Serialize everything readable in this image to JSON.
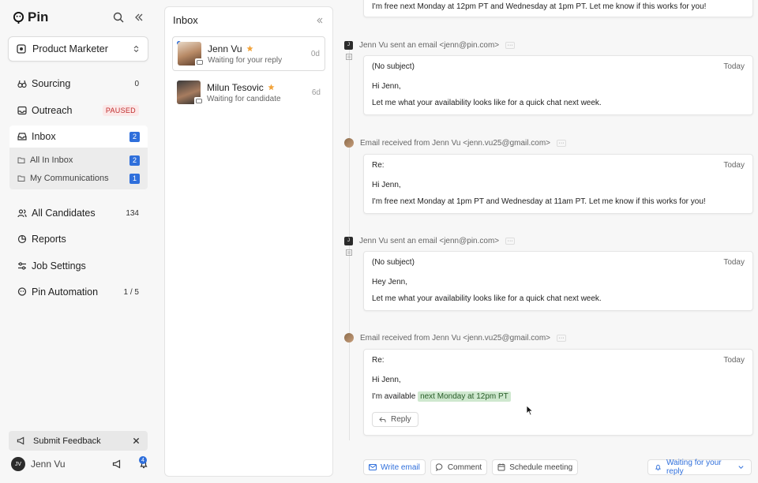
{
  "brand": {
    "name": "Pin"
  },
  "role": {
    "label": "Product Marketer"
  },
  "nav": [
    {
      "label": "Sourcing",
      "count": "0"
    },
    {
      "label": "Outreach",
      "badge": "PAUSED"
    },
    {
      "label": "Inbox",
      "count": "2"
    },
    {
      "label": "All Candidates",
      "count": "134"
    },
    {
      "label": "Reports"
    },
    {
      "label": "Job Settings"
    },
    {
      "label": "Pin Automation",
      "count": "1 / 5"
    }
  ],
  "inbox_sub": [
    {
      "label": "All In Inbox",
      "count": "2"
    },
    {
      "label": "My Communications",
      "count": "1"
    }
  ],
  "feedback": {
    "label": "Submit Feedback"
  },
  "user": {
    "initials": "JV",
    "name": "Jenn Vu",
    "notifications": "4"
  },
  "inbox": {
    "title": "Inbox",
    "conversations": [
      {
        "name": "Jenn Vu",
        "status": "Waiting for your reply",
        "age": "0d"
      },
      {
        "name": "Milun Tesovic",
        "status": "Waiting for candidate",
        "age": "6d"
      }
    ]
  },
  "thread": {
    "top_line": "I'm free next Monday at 12pm PT and Wednesday at 1pm PT. Let me know if this works for you!",
    "events": [
      {
        "head": "Jenn Vu sent an email <jenn@pin.com>",
        "icon_letter": "J",
        "subject": "(No subject)",
        "date": "Today",
        "greeting": "Hi Jenn,",
        "body": "Let me what your availability looks like for a quick chat next week."
      },
      {
        "head": "Email received from Jenn Vu <jenn.vu25@gmail.com>",
        "subject": "Re:",
        "date": "Today",
        "greeting": "Hi Jenn,",
        "body": "I'm free next Monday at 1pm PT and Wednesday at 11am PT. Let me know if this works for you!"
      },
      {
        "head": "Jenn Vu sent an email <jenn@pin.com>",
        "icon_letter": "J",
        "subject": "(No subject)",
        "date": "Today",
        "greeting": "Hey Jenn,",
        "body": "Let me what your availability looks like for a quick chat next week."
      },
      {
        "head": "Email received from Jenn Vu <jenn.vu25@gmail.com>",
        "subject": "Re:",
        "date": "Today",
        "greeting": "Hi Jenn,",
        "body_prefix": "I'm available",
        "body_highlight": "next Monday at 12pm PT",
        "reply_label": "Reply"
      }
    ],
    "actions": {
      "write_email": "Write email",
      "comment": "Comment",
      "schedule": "Schedule meeting",
      "status": "Waiting for your reply"
    },
    "dots": "···"
  },
  "colors": {
    "accent": "#2f6fdb",
    "paused": "#c02c2c",
    "highlight": "#cfe8cf",
    "star": "#f2a33a"
  }
}
